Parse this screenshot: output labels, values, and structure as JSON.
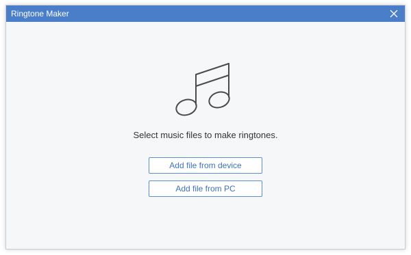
{
  "window": {
    "title": "Ringtone Maker"
  },
  "main": {
    "prompt": "Select music files to make ringtones.",
    "add_device_label": "Add file from device",
    "add_pc_label": "Add file from PC"
  },
  "icons": {
    "close": "close-icon",
    "music": "music-note-icon"
  },
  "colors": {
    "titlebar": "#4a7ec8",
    "accent": "#3f72bd",
    "background": "#f6f7f9"
  }
}
